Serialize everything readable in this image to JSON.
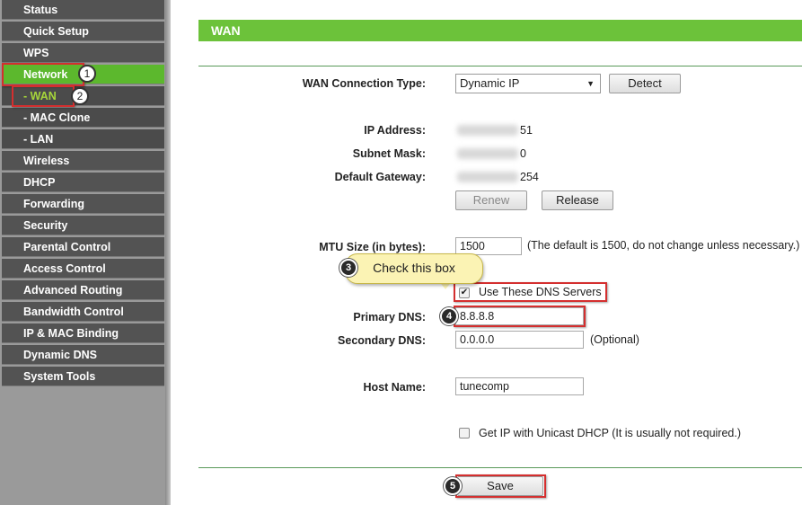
{
  "sidebar": {
    "items": [
      {
        "label": "Status"
      },
      {
        "label": "Quick Setup"
      },
      {
        "label": "WPS"
      },
      {
        "label": "Network"
      },
      {
        "label": "- WAN"
      },
      {
        "label": "- MAC Clone"
      },
      {
        "label": "- LAN"
      },
      {
        "label": "Wireless"
      },
      {
        "label": "DHCP"
      },
      {
        "label": "Forwarding"
      },
      {
        "label": "Security"
      },
      {
        "label": "Parental Control"
      },
      {
        "label": "Access Control"
      },
      {
        "label": "Advanced Routing"
      },
      {
        "label": "Bandwidth Control"
      },
      {
        "label": "IP & MAC Binding"
      },
      {
        "label": "Dynamic DNS"
      },
      {
        "label": "System Tools"
      }
    ]
  },
  "page": {
    "title": "WAN",
    "accent_color": "#6cc23a"
  },
  "form": {
    "connection_type_label": "WAN Connection Type:",
    "connection_type_value": "Dynamic IP",
    "detect_button": "Detect",
    "ip_label": "IP Address:",
    "ip_suffix": "51",
    "mask_label": "Subnet Mask:",
    "mask_suffix": "0",
    "gateway_label": "Default Gateway:",
    "gateway_suffix": "254",
    "renew_button": "Renew",
    "release_button": "Release",
    "mtu_label": "MTU Size (in bytes):",
    "mtu_value": "1500",
    "mtu_note": "(The default is 1500, do not change unless necessary.)",
    "use_dns_label": "Use These DNS Servers",
    "use_dns_checked": true,
    "primary_dns_label": "Primary DNS:",
    "primary_dns_value": "8.8.8.8",
    "secondary_dns_label": "Secondary DNS:",
    "secondary_dns_value": "0.0.0.0",
    "secondary_dns_note": "(Optional)",
    "host_name_label": "Host Name:",
    "host_name_value": "tunecomp",
    "unicast_label": "Get IP with Unicast DHCP (It is usually not required.)",
    "unicast_checked": false,
    "save_button": "Save"
  },
  "annotations": {
    "step1": "1",
    "step2": "2",
    "step3": "3",
    "step4": "4",
    "step5": "5",
    "callout_text": "Check this box",
    "highlight_color": "#d42f2f"
  }
}
